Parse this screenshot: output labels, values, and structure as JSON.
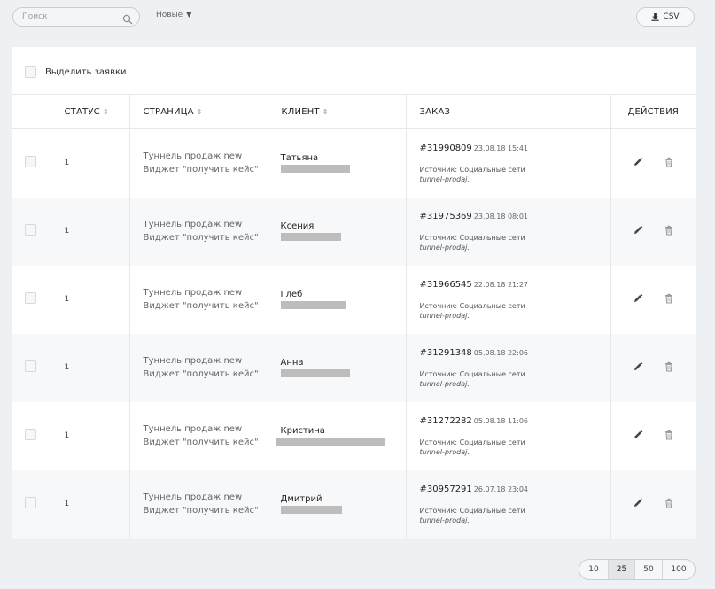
{
  "toolbar": {
    "search_placeholder": "Поиск",
    "sort_label": "Новые",
    "csv_label": "CSV"
  },
  "select_all_label": "Выделить заявки",
  "columns": {
    "status": "СТАТУС",
    "page": "СТРАНИЦА",
    "client": "КЛИЕНТ",
    "order": "ЗАКАЗ",
    "actions": "ДЕЙСТВИЯ"
  },
  "rows": [
    {
      "status": "1",
      "page_line1": "Туннель продаж new",
      "page_line2": "Виджет \"получить кейс\"",
      "client": "Татьяна",
      "order": "#31990809",
      "date": "23.08.18 15:41",
      "source": "Источник: Социальные сети",
      "slug": "tunnel-prodaj."
    },
    {
      "status": "1",
      "page_line1": "Туннель продаж new",
      "page_line2": "Виджет \"получить кейс\"",
      "client": "Ксения",
      "order": "#31975369",
      "date": "23.08.18 08:01",
      "source": "Источник: Социальные сети",
      "slug": "tunnel-prodaj."
    },
    {
      "status": "1",
      "page_line1": "Туннель продаж new",
      "page_line2": "Виджет \"получить кейс\"",
      "client": "Глеб",
      "order": "#31966545",
      "date": "22.08.18 21:27",
      "source": "Источник: Социальные сети",
      "slug": "tunnel-prodaj."
    },
    {
      "status": "1",
      "page_line1": "Туннель продаж new",
      "page_line2": "Виджет \"получить кейс\"",
      "client": "Анна",
      "order": "#31291348",
      "date": "05.08.18 22:06",
      "source": "Источник: Социальные сети",
      "slug": "tunnel-prodaj."
    },
    {
      "status": "1",
      "page_line1": "Туннель продаж new",
      "page_line2": "Виджет \"получить кейс\"",
      "client": "Кристина",
      "order": "#31272282",
      "date": "05.08.18 11:06",
      "source": "Источник: Социальные сети",
      "slug": "tunnel-prodaj."
    },
    {
      "status": "1",
      "page_line1": "Туннель продаж new",
      "page_line2": "Виджет \"получить кейс\"",
      "client": "Дмитрий",
      "order": "#30957291",
      "date": "26.07.18 23:04",
      "source": "Источник: Социальные сети",
      "slug": "tunnel-prodaj."
    }
  ],
  "pagination": {
    "options": [
      "10",
      "25",
      "50",
      "100"
    ],
    "active": "25"
  }
}
